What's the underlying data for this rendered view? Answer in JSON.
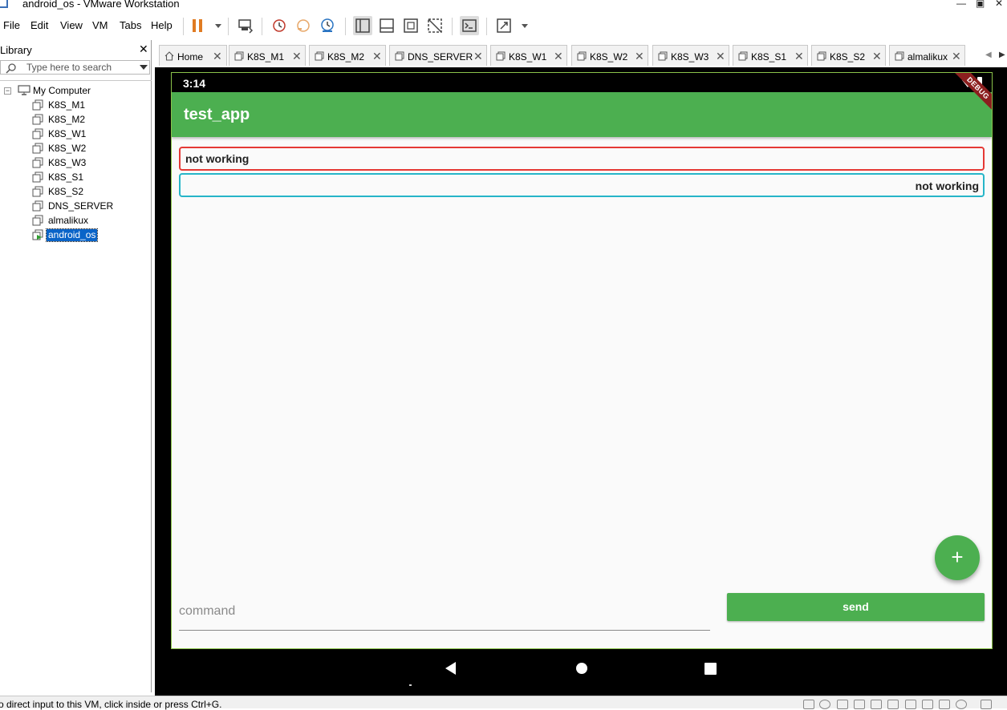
{
  "window": {
    "title": "android_os - VMware Workstation"
  },
  "menu": {
    "items": [
      "File",
      "Edit",
      "View",
      "VM",
      "Tabs",
      "Help"
    ]
  },
  "library": {
    "title": "Library",
    "close_symbol": "✕",
    "search_placeholder": "Type here to search",
    "root_label": "My Computer",
    "root_toggle": "−",
    "items": [
      "K8S_M1",
      "K8S_M2",
      "K8S_W1",
      "K8S_W2",
      "K8S_W3",
      "K8S_S1",
      "K8S_S2",
      "DNS_SERVER",
      "almalikux",
      "android_os"
    ],
    "selected": "android_os"
  },
  "tabs": [
    {
      "label": "Home",
      "icon": "home-icon"
    },
    {
      "label": "K8S_M1",
      "icon": "vm-icon"
    },
    {
      "label": "K8S_M2",
      "icon": "vm-icon"
    },
    {
      "label": "DNS_SERVER",
      "icon": "vm-icon"
    },
    {
      "label": "K8S_W1",
      "icon": "vm-icon"
    },
    {
      "label": "K8S_W2",
      "icon": "vm-icon"
    },
    {
      "label": "K8S_W3",
      "icon": "vm-icon"
    },
    {
      "label": "K8S_S1",
      "icon": "vm-icon"
    },
    {
      "label": "K8S_S2",
      "icon": "vm-icon"
    },
    {
      "label": "almalikux",
      "icon": "vm-icon"
    }
  ],
  "android": {
    "status_time": "3:14",
    "app_title": "test_app",
    "debug_banner": "DEBUG",
    "field1_text": "not working",
    "field2_text": "not working",
    "fab_symbol": "+",
    "command_placeholder": "command",
    "send_label": "send",
    "accent": "#4caf50",
    "field1_border": "#e53935",
    "field2_border": "#26b5c8"
  },
  "status_bar": {
    "text": "o direct input to this VM, click inside or press Ctrl+G."
  }
}
